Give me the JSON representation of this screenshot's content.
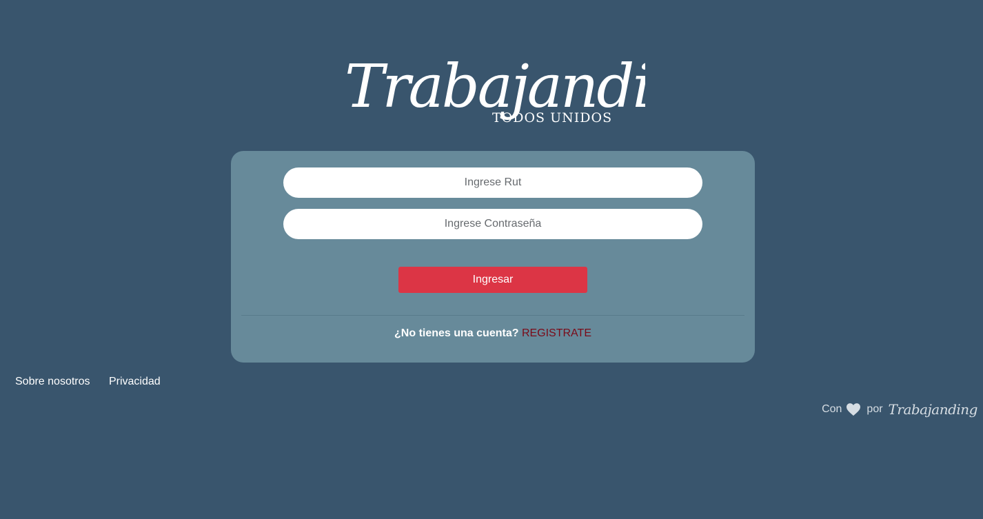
{
  "logo": {
    "brand": "Trabajanding",
    "tagline": "TODOS UNIDOS"
  },
  "login": {
    "rut_placeholder": "Ingrese Rut",
    "password_placeholder": "Ingrese Contraseña",
    "submit_label": "Ingresar",
    "register_question": "¿No tienes una cuenta?",
    "register_link": "REGISTRATE"
  },
  "footer": {
    "links": [
      "Sobre nosotros",
      "Privacidad"
    ],
    "credit_prefix": "Con",
    "credit_icon": "heart-icon",
    "credit_middle": "por",
    "credit_brand": "Trabajanding"
  },
  "colors": {
    "background": "#39556d",
    "card": "#678a9a",
    "primary_button": "#dc3545",
    "register_link": "#7a0a18"
  }
}
